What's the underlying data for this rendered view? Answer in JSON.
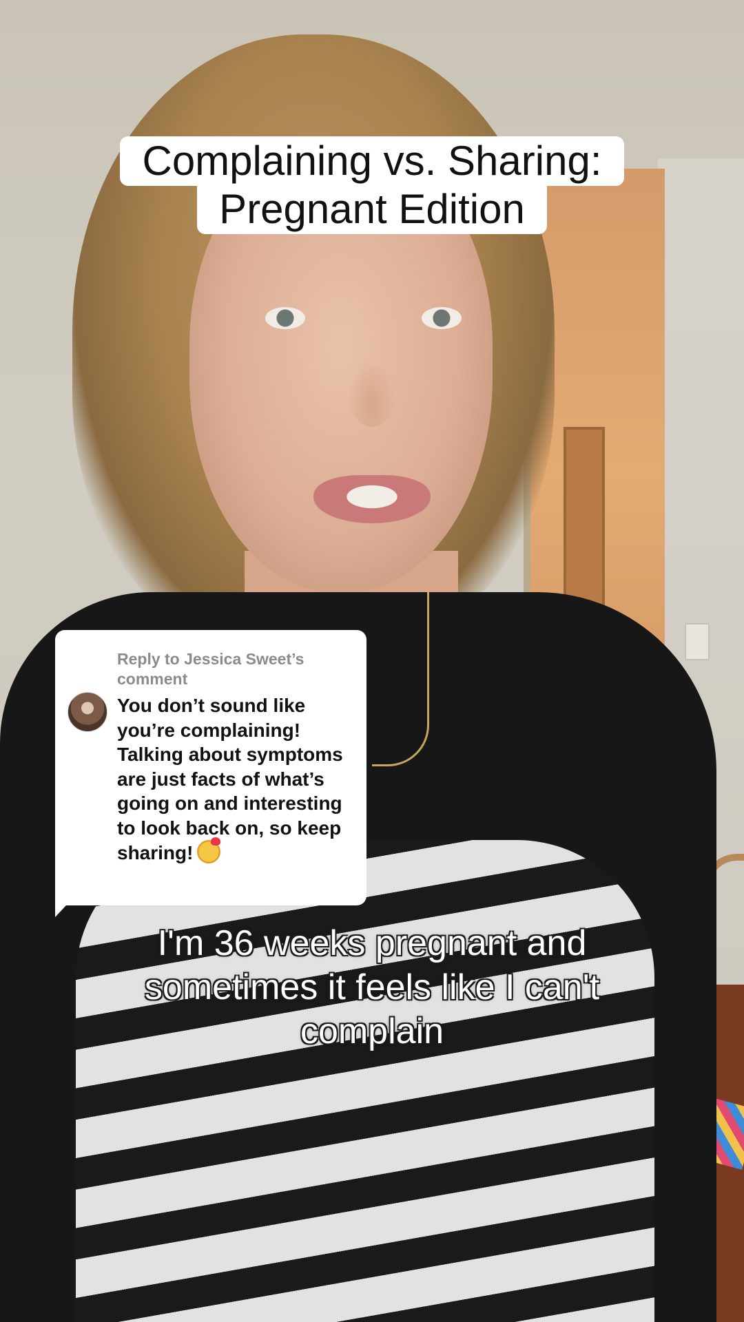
{
  "title": {
    "line1": "Complaining vs. Sharing:",
    "line2": "Pregnant Edition"
  },
  "reply": {
    "header": "Reply to Jessica Sweet’s comment",
    "body": "You don’t sound like you’re complaining! Talking about symptoms are just facts of what’s going on and interesting to look back on, so keep sharing!",
    "emoji": "smiling-face-with-hearts-icon"
  },
  "caption": {
    "text": "I'm 36 weeks pregnant and sometimes it feels like I can't complain"
  },
  "colors": {
    "overlay_bg": "#ffffff",
    "overlay_text": "#111111",
    "reply_header_text": "#8b8b8b",
    "caption_text": "#ffffff"
  }
}
